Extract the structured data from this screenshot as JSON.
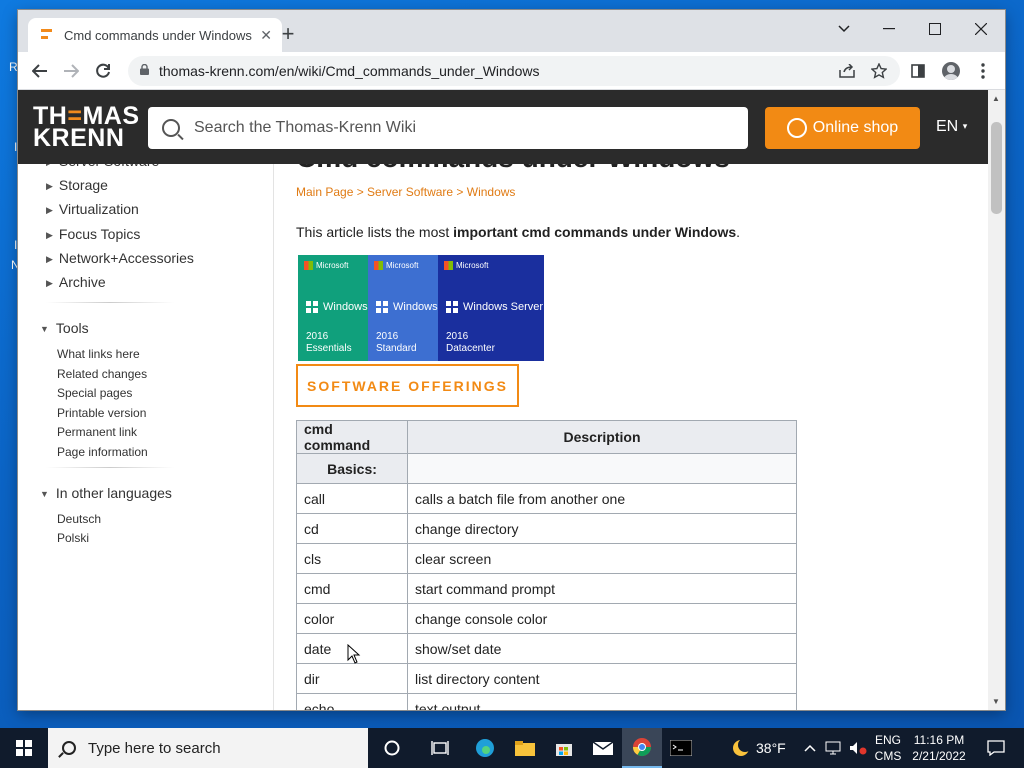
{
  "desktop": {
    "edge_letters": [
      "R",
      "I",
      "I",
      "N"
    ]
  },
  "browser": {
    "tab_title": "Cmd commands under Windows",
    "url": "thomas-krenn.com/en/wiki/Cmd_commands_under_Windows"
  },
  "site": {
    "logo_line1_pre": "TH",
    "logo_line1_accent": "=",
    "logo_line1_post": "MAS",
    "logo_line2": "KRENN",
    "search_placeholder": "Search the Thomas-Krenn Wiki",
    "shop_label": "Online shop",
    "lang_label": "EN"
  },
  "sidebar": {
    "nav_items": [
      "Server Software",
      "Storage",
      "Virtualization",
      "Focus Topics",
      "Network+Accessories",
      "Archive"
    ],
    "tools_heading": "Tools",
    "tools": [
      "What links here",
      "Related changes",
      "Special pages",
      "Printable version",
      "Permanent link",
      "Page information"
    ],
    "languages_heading": "In other languages",
    "languages": [
      "Deutsch",
      "Polski"
    ]
  },
  "article": {
    "title": "Cmd commands under Windows",
    "breadcrumb": "Main Page > Server Software > Windows",
    "intro_prefix": "This article lists the most ",
    "intro_bold": "important cmd commands under Windows",
    "intro_suffix": ".",
    "banner": [
      {
        "brand": "Microsoft",
        "product": "Windows",
        "edition_year": "2016",
        "edition": "Essentials",
        "color": "#10a07c"
      },
      {
        "brand": "Microsoft",
        "product": "Windows",
        "edition_year": "2016",
        "edition": "Standard",
        "color": "#3d6fd1"
      },
      {
        "brand": "Microsoft",
        "product": "Windows Server",
        "edition_year": "2016",
        "edition": "Datacenter",
        "color": "#1a2f9e"
      }
    ],
    "software_offerings_label": "SOFTWARE OFFERINGS",
    "table": {
      "headers": [
        "cmd command",
        "Description"
      ],
      "section": "Basics:",
      "rows": [
        [
          "call",
          "calls a batch file from another one"
        ],
        [
          "cd",
          "change directory"
        ],
        [
          "cls",
          "clear screen"
        ],
        [
          "cmd",
          "start command prompt"
        ],
        [
          "color",
          "change console color"
        ],
        [
          "date",
          "show/set date"
        ],
        [
          "dir",
          "list directory content"
        ],
        [
          "echo",
          "text output"
        ]
      ]
    }
  },
  "taskbar": {
    "search_placeholder": "Type here to search",
    "weather": "38°F",
    "lang_top": "ENG",
    "lang_bottom": "CMS",
    "time": "11:16 PM",
    "date": "2/21/2022"
  }
}
